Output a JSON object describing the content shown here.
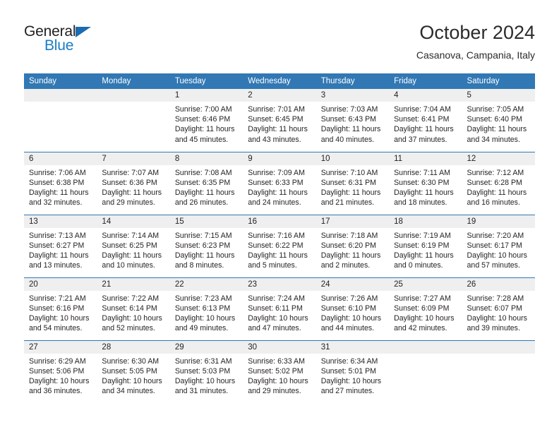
{
  "logo": {
    "line1": "General",
    "line2": "Blue",
    "triangle_icon": "triangle-icon",
    "color_dark": "#231f20",
    "color_blue": "#1a7dc4"
  },
  "header": {
    "title": "October 2024",
    "subtitle": "Casanova, Campania, Italy"
  },
  "theme": {
    "header_bg": "#3178b4",
    "header_text": "#ffffff",
    "daynum_bg": "#efefef",
    "body_text": "#231f20"
  },
  "calendar": {
    "weekday_headers": [
      "Sunday",
      "Monday",
      "Tuesday",
      "Wednesday",
      "Thursday",
      "Friday",
      "Saturday"
    ],
    "labels": {
      "sunrise": "Sunrise:",
      "sunset": "Sunset:",
      "daylight": "Daylight:"
    },
    "weeks": [
      [
        {
          "day": "",
          "empty": true
        },
        {
          "day": "",
          "empty": true
        },
        {
          "day": "1",
          "sunrise": "Sunrise: 7:00 AM",
          "sunset": "Sunset: 6:46 PM",
          "daylight": "Daylight: 11 hours and 45 minutes."
        },
        {
          "day": "2",
          "sunrise": "Sunrise: 7:01 AM",
          "sunset": "Sunset: 6:45 PM",
          "daylight": "Daylight: 11 hours and 43 minutes."
        },
        {
          "day": "3",
          "sunrise": "Sunrise: 7:03 AM",
          "sunset": "Sunset: 6:43 PM",
          "daylight": "Daylight: 11 hours and 40 minutes."
        },
        {
          "day": "4",
          "sunrise": "Sunrise: 7:04 AM",
          "sunset": "Sunset: 6:41 PM",
          "daylight": "Daylight: 11 hours and 37 minutes."
        },
        {
          "day": "5",
          "sunrise": "Sunrise: 7:05 AM",
          "sunset": "Sunset: 6:40 PM",
          "daylight": "Daylight: 11 hours and 34 minutes."
        }
      ],
      [
        {
          "day": "6",
          "sunrise": "Sunrise: 7:06 AM",
          "sunset": "Sunset: 6:38 PM",
          "daylight": "Daylight: 11 hours and 32 minutes."
        },
        {
          "day": "7",
          "sunrise": "Sunrise: 7:07 AM",
          "sunset": "Sunset: 6:36 PM",
          "daylight": "Daylight: 11 hours and 29 minutes."
        },
        {
          "day": "8",
          "sunrise": "Sunrise: 7:08 AM",
          "sunset": "Sunset: 6:35 PM",
          "daylight": "Daylight: 11 hours and 26 minutes."
        },
        {
          "day": "9",
          "sunrise": "Sunrise: 7:09 AM",
          "sunset": "Sunset: 6:33 PM",
          "daylight": "Daylight: 11 hours and 24 minutes."
        },
        {
          "day": "10",
          "sunrise": "Sunrise: 7:10 AM",
          "sunset": "Sunset: 6:31 PM",
          "daylight": "Daylight: 11 hours and 21 minutes."
        },
        {
          "day": "11",
          "sunrise": "Sunrise: 7:11 AM",
          "sunset": "Sunset: 6:30 PM",
          "daylight": "Daylight: 11 hours and 18 minutes."
        },
        {
          "day": "12",
          "sunrise": "Sunrise: 7:12 AM",
          "sunset": "Sunset: 6:28 PM",
          "daylight": "Daylight: 11 hours and 16 minutes."
        }
      ],
      [
        {
          "day": "13",
          "sunrise": "Sunrise: 7:13 AM",
          "sunset": "Sunset: 6:27 PM",
          "daylight": "Daylight: 11 hours and 13 minutes."
        },
        {
          "day": "14",
          "sunrise": "Sunrise: 7:14 AM",
          "sunset": "Sunset: 6:25 PM",
          "daylight": "Daylight: 11 hours and 10 minutes."
        },
        {
          "day": "15",
          "sunrise": "Sunrise: 7:15 AM",
          "sunset": "Sunset: 6:23 PM",
          "daylight": "Daylight: 11 hours and 8 minutes."
        },
        {
          "day": "16",
          "sunrise": "Sunrise: 7:16 AM",
          "sunset": "Sunset: 6:22 PM",
          "daylight": "Daylight: 11 hours and 5 minutes."
        },
        {
          "day": "17",
          "sunrise": "Sunrise: 7:18 AM",
          "sunset": "Sunset: 6:20 PM",
          "daylight": "Daylight: 11 hours and 2 minutes."
        },
        {
          "day": "18",
          "sunrise": "Sunrise: 7:19 AM",
          "sunset": "Sunset: 6:19 PM",
          "daylight": "Daylight: 11 hours and 0 minutes."
        },
        {
          "day": "19",
          "sunrise": "Sunrise: 7:20 AM",
          "sunset": "Sunset: 6:17 PM",
          "daylight": "Daylight: 10 hours and 57 minutes."
        }
      ],
      [
        {
          "day": "20",
          "sunrise": "Sunrise: 7:21 AM",
          "sunset": "Sunset: 6:16 PM",
          "daylight": "Daylight: 10 hours and 54 minutes."
        },
        {
          "day": "21",
          "sunrise": "Sunrise: 7:22 AM",
          "sunset": "Sunset: 6:14 PM",
          "daylight": "Daylight: 10 hours and 52 minutes."
        },
        {
          "day": "22",
          "sunrise": "Sunrise: 7:23 AM",
          "sunset": "Sunset: 6:13 PM",
          "daylight": "Daylight: 10 hours and 49 minutes."
        },
        {
          "day": "23",
          "sunrise": "Sunrise: 7:24 AM",
          "sunset": "Sunset: 6:11 PM",
          "daylight": "Daylight: 10 hours and 47 minutes."
        },
        {
          "day": "24",
          "sunrise": "Sunrise: 7:26 AM",
          "sunset": "Sunset: 6:10 PM",
          "daylight": "Daylight: 10 hours and 44 minutes."
        },
        {
          "day": "25",
          "sunrise": "Sunrise: 7:27 AM",
          "sunset": "Sunset: 6:09 PM",
          "daylight": "Daylight: 10 hours and 42 minutes."
        },
        {
          "day": "26",
          "sunrise": "Sunrise: 7:28 AM",
          "sunset": "Sunset: 6:07 PM",
          "daylight": "Daylight: 10 hours and 39 minutes."
        }
      ],
      [
        {
          "day": "27",
          "sunrise": "Sunrise: 6:29 AM",
          "sunset": "Sunset: 5:06 PM",
          "daylight": "Daylight: 10 hours and 36 minutes."
        },
        {
          "day": "28",
          "sunrise": "Sunrise: 6:30 AM",
          "sunset": "Sunset: 5:05 PM",
          "daylight": "Daylight: 10 hours and 34 minutes."
        },
        {
          "day": "29",
          "sunrise": "Sunrise: 6:31 AM",
          "sunset": "Sunset: 5:03 PM",
          "daylight": "Daylight: 10 hours and 31 minutes."
        },
        {
          "day": "30",
          "sunrise": "Sunrise: 6:33 AM",
          "sunset": "Sunset: 5:02 PM",
          "daylight": "Daylight: 10 hours and 29 minutes."
        },
        {
          "day": "31",
          "sunrise": "Sunrise: 6:34 AM",
          "sunset": "Sunset: 5:01 PM",
          "daylight": "Daylight: 10 hours and 27 minutes."
        },
        {
          "day": "",
          "empty": true
        },
        {
          "day": "",
          "empty": true
        }
      ]
    ]
  }
}
